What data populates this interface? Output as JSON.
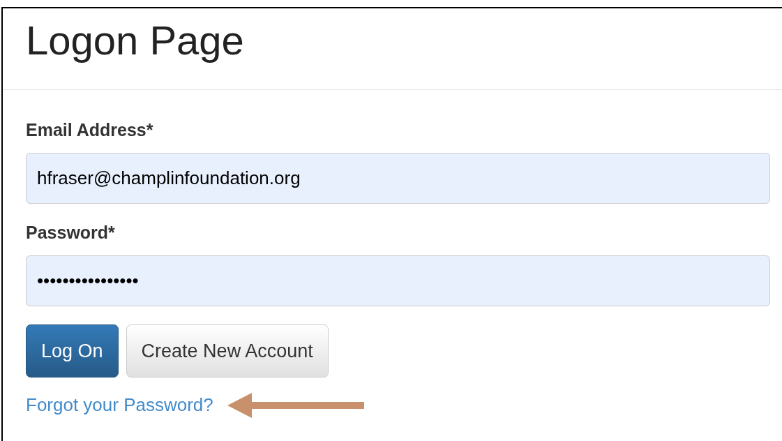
{
  "title": "Logon Page",
  "fields": [
    {
      "label": "Email Address*",
      "value": "hfraser@champlinfoundation.org"
    },
    {
      "label": "Password*",
      "value": "••••••••••••••••"
    }
  ],
  "buttons": [
    {
      "label": "Log On",
      "kind": "primary"
    },
    {
      "label": "Create New Account",
      "kind": "default"
    }
  ],
  "link": "Forgot your Password?"
}
